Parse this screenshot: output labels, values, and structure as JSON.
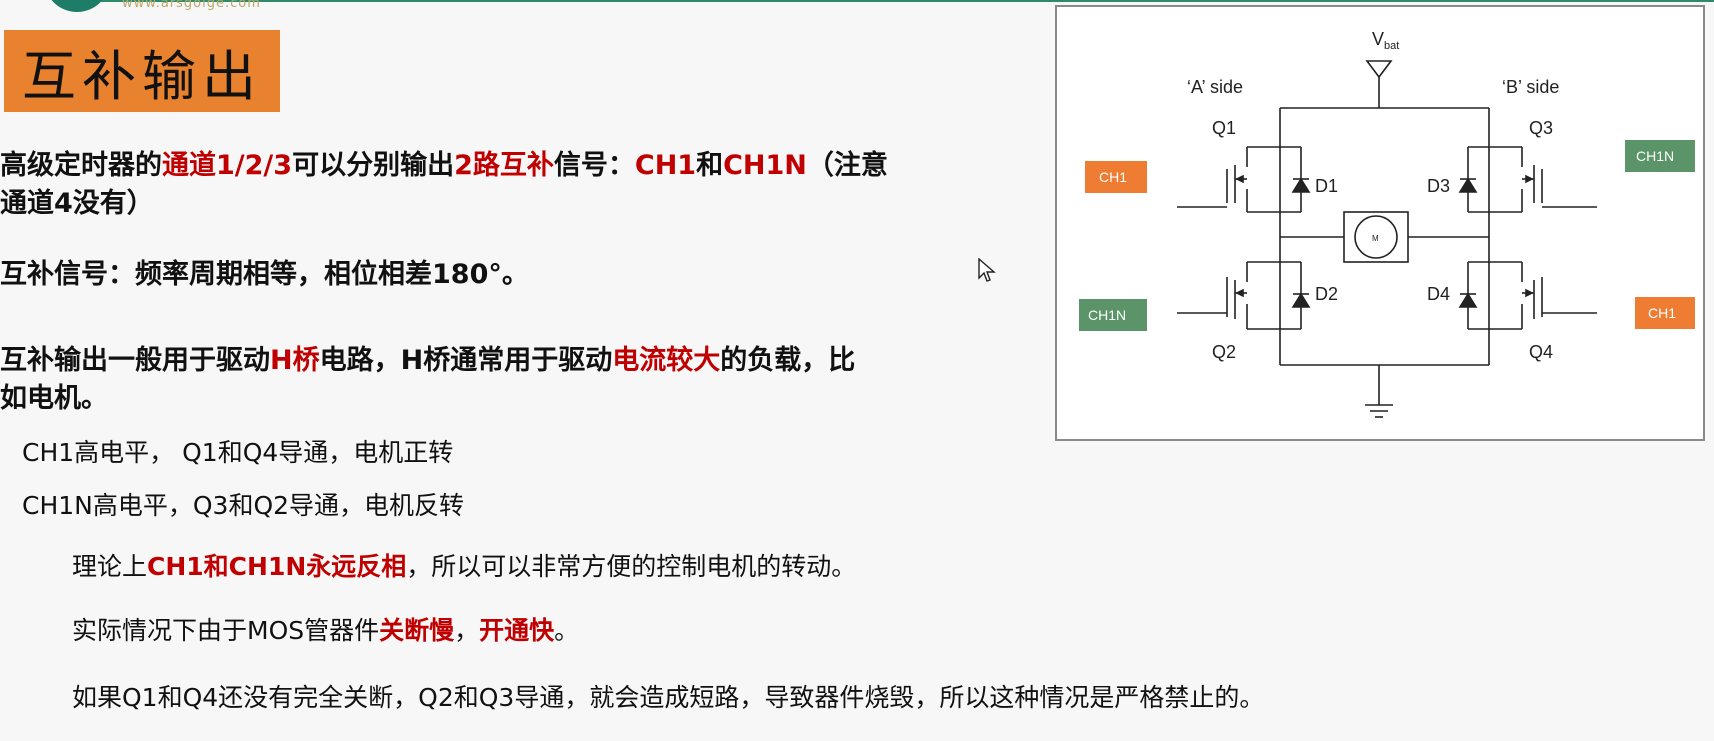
{
  "header": {
    "logo_url": "www.arsgoige.com"
  },
  "slide": {
    "title": "互补输出",
    "para1": {
      "l1_a": "高级定时器的",
      "l1_b": "通道1/2/3",
      "l1_c": "可以分别输出",
      "l1_d": "2路互补",
      "l1_e": "信号：",
      "l1_f": "CH1",
      "l1_g": "和",
      "l1_h": "CH1N",
      "l1_i": "（注意",
      "l2": "通道4没有）"
    },
    "para2": "互补信号：频率周期相等，相位相差180°。",
    "para3": {
      "l1_a": "互补输出一般用于驱动",
      "l1_b": "H桥",
      "l1_c": "电路，H桥通常用于驱动",
      "l1_d": "电流较大",
      "l1_e": "的负载，比",
      "l2": "如电机。"
    },
    "note1": "CH1高电平，  Q1和Q4导通，电机正转",
    "note2": "CH1N高电平，Q3和Q2导通，电机反转",
    "note3": {
      "a": "理论上",
      "b": "CH1和CH1N永远反相",
      "c": "，所以可以非常方便的控制电机的转动。"
    },
    "note4": {
      "a": "实际情况下由于MOS管器件",
      "b": "关断慢",
      "c": "，",
      "d": "开通快",
      "e": "。"
    },
    "note5": "如果Q1和Q4还没有完全关断，Q2和Q3导通，就会造成短路，导致器件烧毁，所以这种情况是严格禁止的。"
  },
  "diagram": {
    "vbat_main": "V",
    "vbat_sub": "bat",
    "side_a": "‘A’ side",
    "side_b": "‘B’ side",
    "q1": "Q1",
    "q2": "Q2",
    "q3": "Q3",
    "q4": "Q4",
    "d1": "D1",
    "d2": "D2",
    "d3": "D3",
    "d4": "D4",
    "motor": "M",
    "chip_tl": "CH1",
    "chip_bl": "CH1N",
    "chip_tr": "CH1N",
    "chip_br": "CH1",
    "colors": {
      "ch1_chip": "#ee7d33",
      "ch1n_chip": "#5a9468",
      "wire": "#222222"
    }
  }
}
